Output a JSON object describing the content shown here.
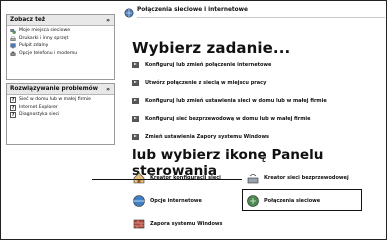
{
  "sidebar": {
    "see_also": {
      "title": "Zobacz też",
      "chevron": "»",
      "items": [
        {
          "label": "Moje miejsca sieciowe",
          "icon": "network-places-icon"
        },
        {
          "label": "Drukarki i inny sprzęt",
          "icon": "printer-icon"
        },
        {
          "label": "Pulpit zdalny",
          "icon": "remote-desktop-icon"
        },
        {
          "label": "Opcje telefonu i modemu",
          "icon": "phone-modem-icon"
        }
      ]
    },
    "troubleshoot": {
      "title": "Rozwiązywanie problemów",
      "chevron": "»",
      "items": [
        {
          "label": "Sieć w domu lub w małej firmie",
          "icon": "help-icon"
        },
        {
          "label": "Internet Explorer",
          "icon": "help-icon"
        },
        {
          "label": "Diagnostyka sieci",
          "icon": "help-icon"
        }
      ]
    }
  },
  "main": {
    "category_title": "Połączenia sieciowe i internetowe",
    "tasks_title": "Wybierz zadanie...",
    "tasks": [
      "Konfiguruj lub zmień połączenie internetowe",
      "Utwórz połączenie z siecią w miejscu pracy",
      "Konfiguruj lub zmień ustawienia sieci w domu lub w małej firmie",
      "Konfiguruj sieć bezprzewodową w domu lub w małej firmie",
      "Zmień ustawienia Zapory systemu Windows"
    ],
    "panel_title": "lub wybierz ikonę Panelu sterowania",
    "panel_items": {
      "network_wizard": "Kreator konfiguracji sieci",
      "wireless_wizard": "Kreator sieci bezprzewodowej",
      "internet_options": "Opcje internetowe",
      "network_connections": "Połączenia sieciowe",
      "firewall": "Zapora systemu Windows"
    }
  }
}
